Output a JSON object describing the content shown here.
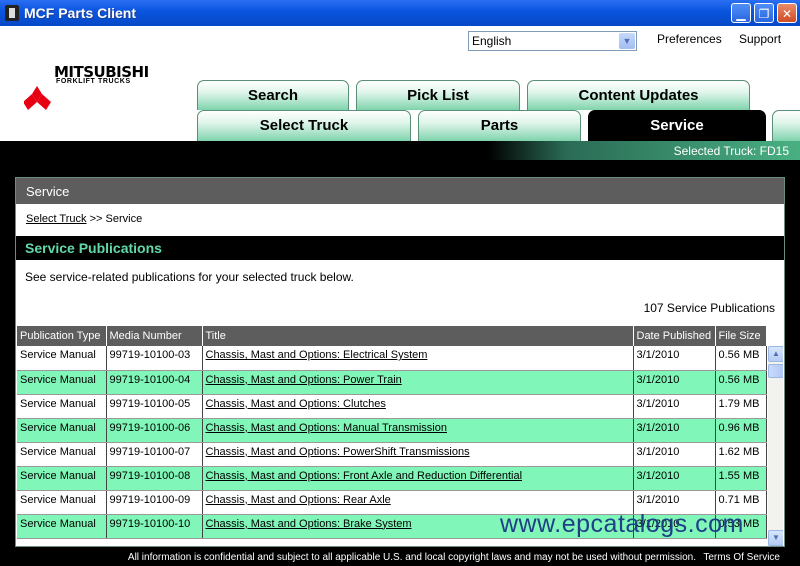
{
  "window": {
    "title": "MCF Parts Client",
    "controls": {
      "minimize": "▁",
      "maximize": "❐",
      "close": "✕"
    }
  },
  "header": {
    "language_select": {
      "value": "English",
      "arrow": "▼"
    },
    "links": {
      "preferences": "Preferences",
      "support": "Support"
    },
    "logo": {
      "name": "MITSUBISHI",
      "sub": "FORKLIFT TRUCKS"
    }
  },
  "tabs": {
    "row1": [
      "Search",
      "Pick List",
      "Content Updates"
    ],
    "row2": [
      "Select Truck",
      "Parts",
      "Service"
    ],
    "active": "Service"
  },
  "selected_truck": {
    "label": "Selected Truck:",
    "value": "FD15"
  },
  "panel": {
    "title": "Service",
    "breadcrumb": {
      "link": "Select Truck",
      "sep": ">>",
      "current": "Service"
    },
    "section_title": "Service Publications",
    "description": "See service-related publications for your selected truck below.",
    "count": "107 Service Publications"
  },
  "table": {
    "headers": [
      "Publication Type",
      "Media Number",
      "Title",
      "Date Published",
      "File Size"
    ],
    "rows": [
      {
        "type": "Service Manual",
        "media": "99719-10100-03",
        "title": "Chassis, Mast and Options: Electrical System",
        "date": "3/1/2010",
        "size": "0.56 MB"
      },
      {
        "type": "Service Manual",
        "media": "99719-10100-04",
        "title": "Chassis, Mast and Options: Power Train",
        "date": "3/1/2010",
        "size": "0.56 MB"
      },
      {
        "type": "Service Manual",
        "media": "99719-10100-05",
        "title": "Chassis, Mast and Options: Clutches",
        "date": "3/1/2010",
        "size": "1.79 MB"
      },
      {
        "type": "Service Manual",
        "media": "99719-10100-06",
        "title": "Chassis, Mast and Options: Manual Transmission",
        "date": "3/1/2010",
        "size": "0.96 MB"
      },
      {
        "type": "Service Manual",
        "media": "99719-10100-07",
        "title": "Chassis, Mast and Options: PowerShift Transmissions",
        "date": "3/1/2010",
        "size": "1.62 MB"
      },
      {
        "type": "Service Manual",
        "media": "99719-10100-08",
        "title": "Chassis, Mast and Options: Front Axle and Reduction Differential",
        "date": "3/1/2010",
        "size": "1.55 MB"
      },
      {
        "type": "Service Manual",
        "media": "99719-10100-09",
        "title": "Chassis, Mast and Options: Rear Axle",
        "date": "3/1/2010",
        "size": "0.71 MB"
      },
      {
        "type": "Service Manual",
        "media": "99719-10100-10",
        "title": "Chassis, Mast and Options: Brake System",
        "date": "3/1/2010",
        "size": "0.53 MB"
      }
    ]
  },
  "watermark": "www.epcatalogs.com",
  "footer": {
    "disclaimer": "All information is confidential and subject to all applicable U.S. and local copyright laws and may not be used without permission.",
    "terms": "Terms Of Service"
  },
  "colors": {
    "accent": "#62d8a8",
    "row_alt": "#80f7b8",
    "titlebar": "#0b56e0"
  }
}
